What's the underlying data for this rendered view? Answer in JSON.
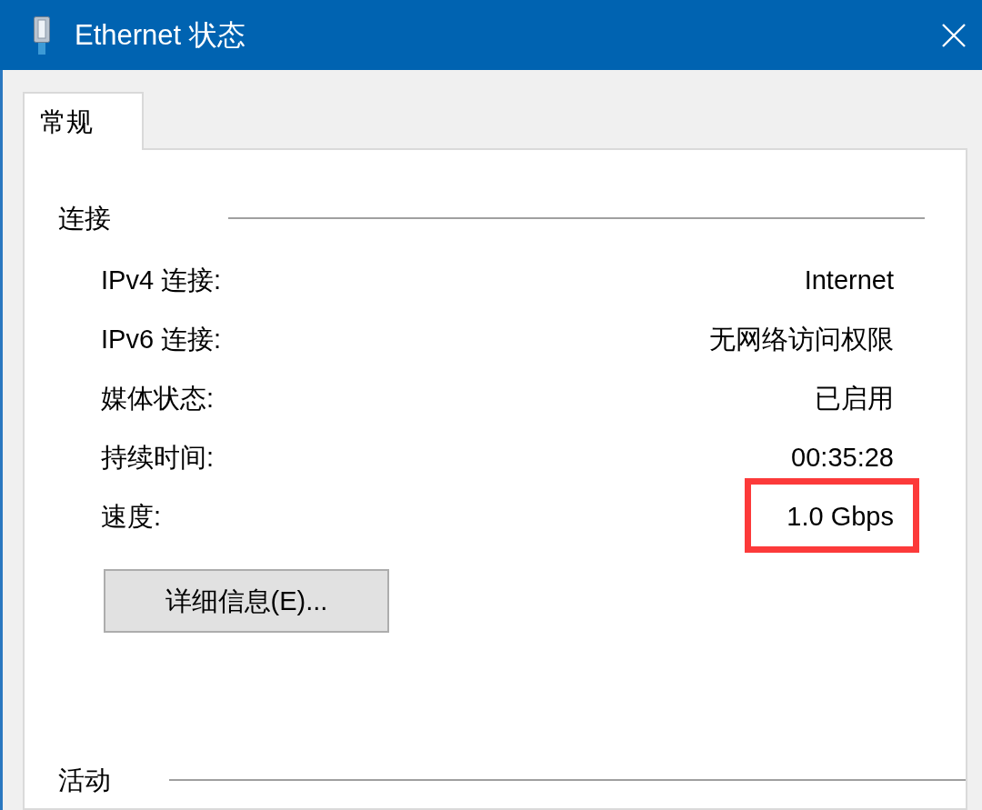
{
  "window": {
    "title": "Ethernet 状态"
  },
  "tabs": [
    {
      "label": "常规",
      "selected": true
    }
  ],
  "sections": [
    {
      "title": "连接",
      "rows": [
        {
          "label": "IPv4 连接:",
          "value": "Internet",
          "highlighted": false
        },
        {
          "label": "IPv6 连接:",
          "value": "无网络访问权限",
          "highlighted": false
        },
        {
          "label": "媒体状态:",
          "value": "已启用",
          "highlighted": false
        },
        {
          "label": "持续时间:",
          "value": "00:35:28",
          "highlighted": false
        },
        {
          "label": "速度:",
          "value": "1.0 Gbps",
          "highlighted": true
        }
      ],
      "buttons": [
        "详细信息(E)..."
      ]
    },
    {
      "title": "活动"
    }
  ]
}
